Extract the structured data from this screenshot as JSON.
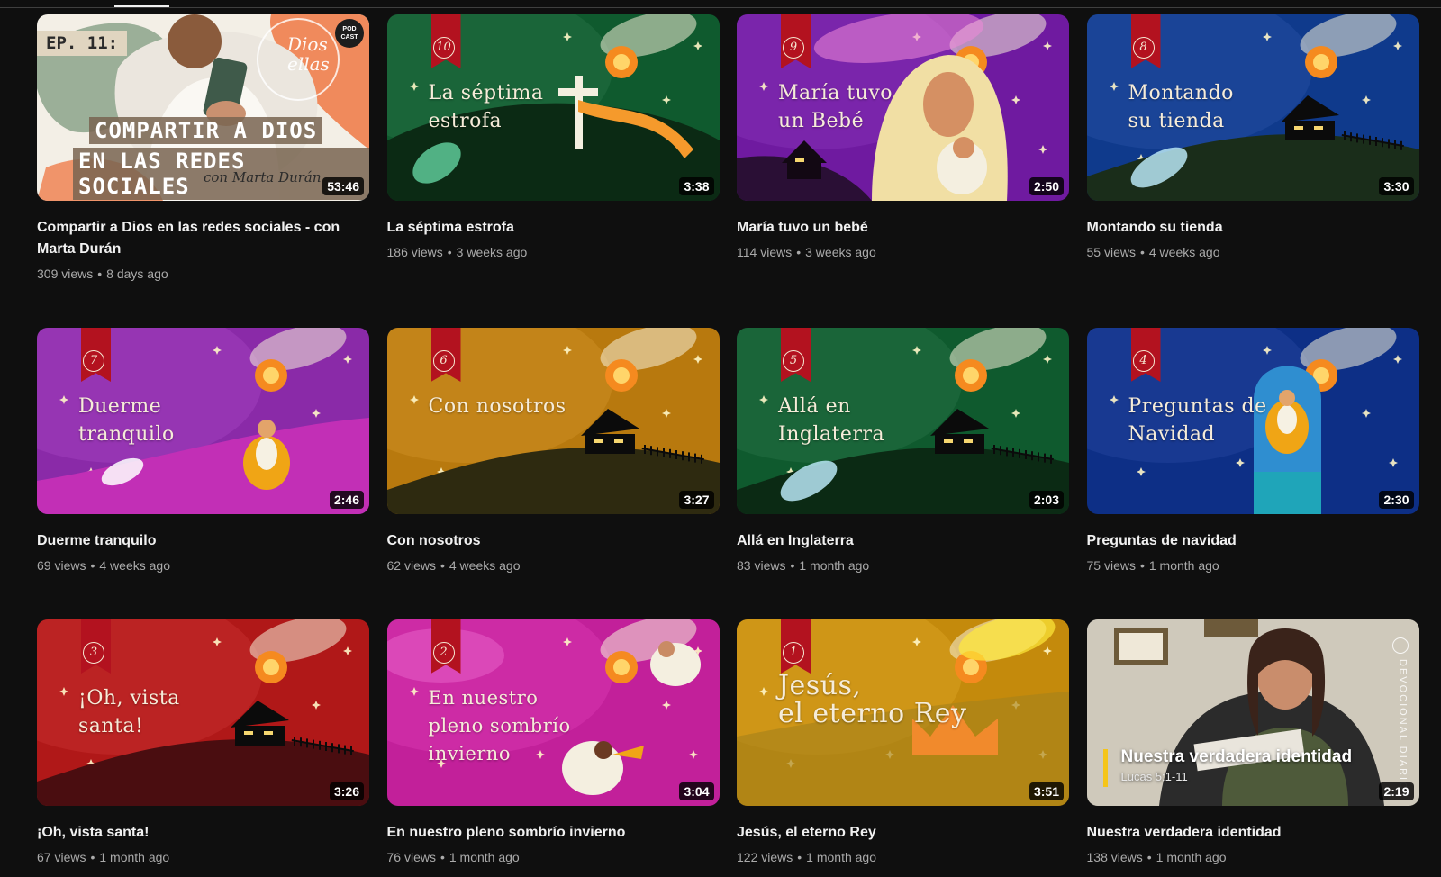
{
  "videos": [
    {
      "title": "Compartir a Dios en las redes sociales - con Marta Durán",
      "views": "309 views",
      "age": "8 days ago",
      "duration": "53:46",
      "thumb": {
        "style": "podcast",
        "ep": "EP. 11:",
        "line1": "COMPARTIR A DIOS",
        "line2": "EN LAS REDES SOCIALES",
        "sub": "con Marta Durán",
        "dios": "Dios\nellas",
        "logo": "POD\nCAST"
      }
    },
    {
      "title": "La séptima estrofa",
      "views": "186 views",
      "age": "3 weeks ago",
      "duration": "3:38",
      "thumb": {
        "style": "advent",
        "number": "10",
        "text": "La séptima\nestrofa",
        "bg": "#0f5a2e",
        "hill": "#0b2a14",
        "accent": "cross"
      }
    },
    {
      "title": "María tuvo un bebé",
      "views": "114 views",
      "age": "3 weeks ago",
      "duration": "2:50",
      "thumb": {
        "style": "advent",
        "number": "9",
        "text": "María tuvo\nun Bebé",
        "bg": "#6f1aa0",
        "hill": "#2a0f35",
        "accent": "mary"
      }
    },
    {
      "title": "Montando su tienda",
      "views": "55 views",
      "age": "4 weeks ago",
      "duration": "3:30",
      "thumb": {
        "style": "advent",
        "number": "8",
        "text": "Montando\nsu tienda",
        "bg": "#0f3a8c",
        "hill": "#1a2d1a",
        "accent": "house"
      }
    },
    {
      "title": "Duerme tranquilo",
      "views": "69 views",
      "age": "4 weeks ago",
      "duration": "2:46",
      "thumb": {
        "style": "advent",
        "number": "7",
        "text": "Duerme\ntranquilo",
        "bg": "#8a2aa8",
        "hill": "#c22fb6",
        "accent": "manger"
      }
    },
    {
      "title": "Con nosotros",
      "views": "62 views",
      "age": "4 weeks ago",
      "duration": "3:27",
      "thumb": {
        "style": "advent",
        "number": "6",
        "text": "Con nosotros",
        "bg": "#b8790e",
        "hill": "#2e2a10",
        "accent": "house"
      }
    },
    {
      "title": "Allá en Inglaterra",
      "views": "83 views",
      "age": "1 month ago",
      "duration": "2:03",
      "thumb": {
        "style": "advent",
        "number": "5",
        "text": "Allá en\nInglaterra",
        "bg": "#0f5a2e",
        "hill": "#0b2a14",
        "accent": "house"
      }
    },
    {
      "title": "Preguntas de navidad",
      "views": "75 views",
      "age": "1 month ago",
      "duration": "2:30",
      "thumb": {
        "style": "advent",
        "number": "4",
        "text": "Preguntas de\nNavidad",
        "bg": "#0d2f86",
        "hill": "#0d2f86",
        "accent": "arch"
      }
    },
    {
      "title": "¡Oh, vista santa!",
      "views": "67 views",
      "age": "1 month ago",
      "duration": "3:26",
      "thumb": {
        "style": "advent",
        "number": "3",
        "text": "¡Oh, vista\nsanta!",
        "bg": "#b01818",
        "hill": "#4a0d10",
        "accent": "house"
      }
    },
    {
      "title": "En nuestro pleno sombrío invierno",
      "views": "76 views",
      "age": "1 month ago",
      "duration": "3:04",
      "thumb": {
        "style": "advent",
        "number": "2",
        "text": "En nuestro\npleno sombrío\ninvierno",
        "bg": "#c2209a",
        "hill": "#c2209a",
        "accent": "angels"
      }
    },
    {
      "title": "Jesús, el eterno Rey",
      "views": "122 views",
      "age": "1 month ago",
      "duration": "3:51",
      "thumb": {
        "style": "advent",
        "number": "1",
        "text": "Jesús,\nel eterno Rey",
        "bg": "#c48a0c",
        "hill": "#c48a0c",
        "accent": "crown"
      }
    },
    {
      "title": "Nuestra verdadera identidad",
      "views": "138 views",
      "age": "1 month ago",
      "duration": "2:19",
      "thumb": {
        "style": "devocional",
        "headline": "Nuestra verdadera identidad",
        "ref": "Lucas 5:1-11",
        "side": "DEVOCIONAL DIARIO"
      }
    }
  ]
}
